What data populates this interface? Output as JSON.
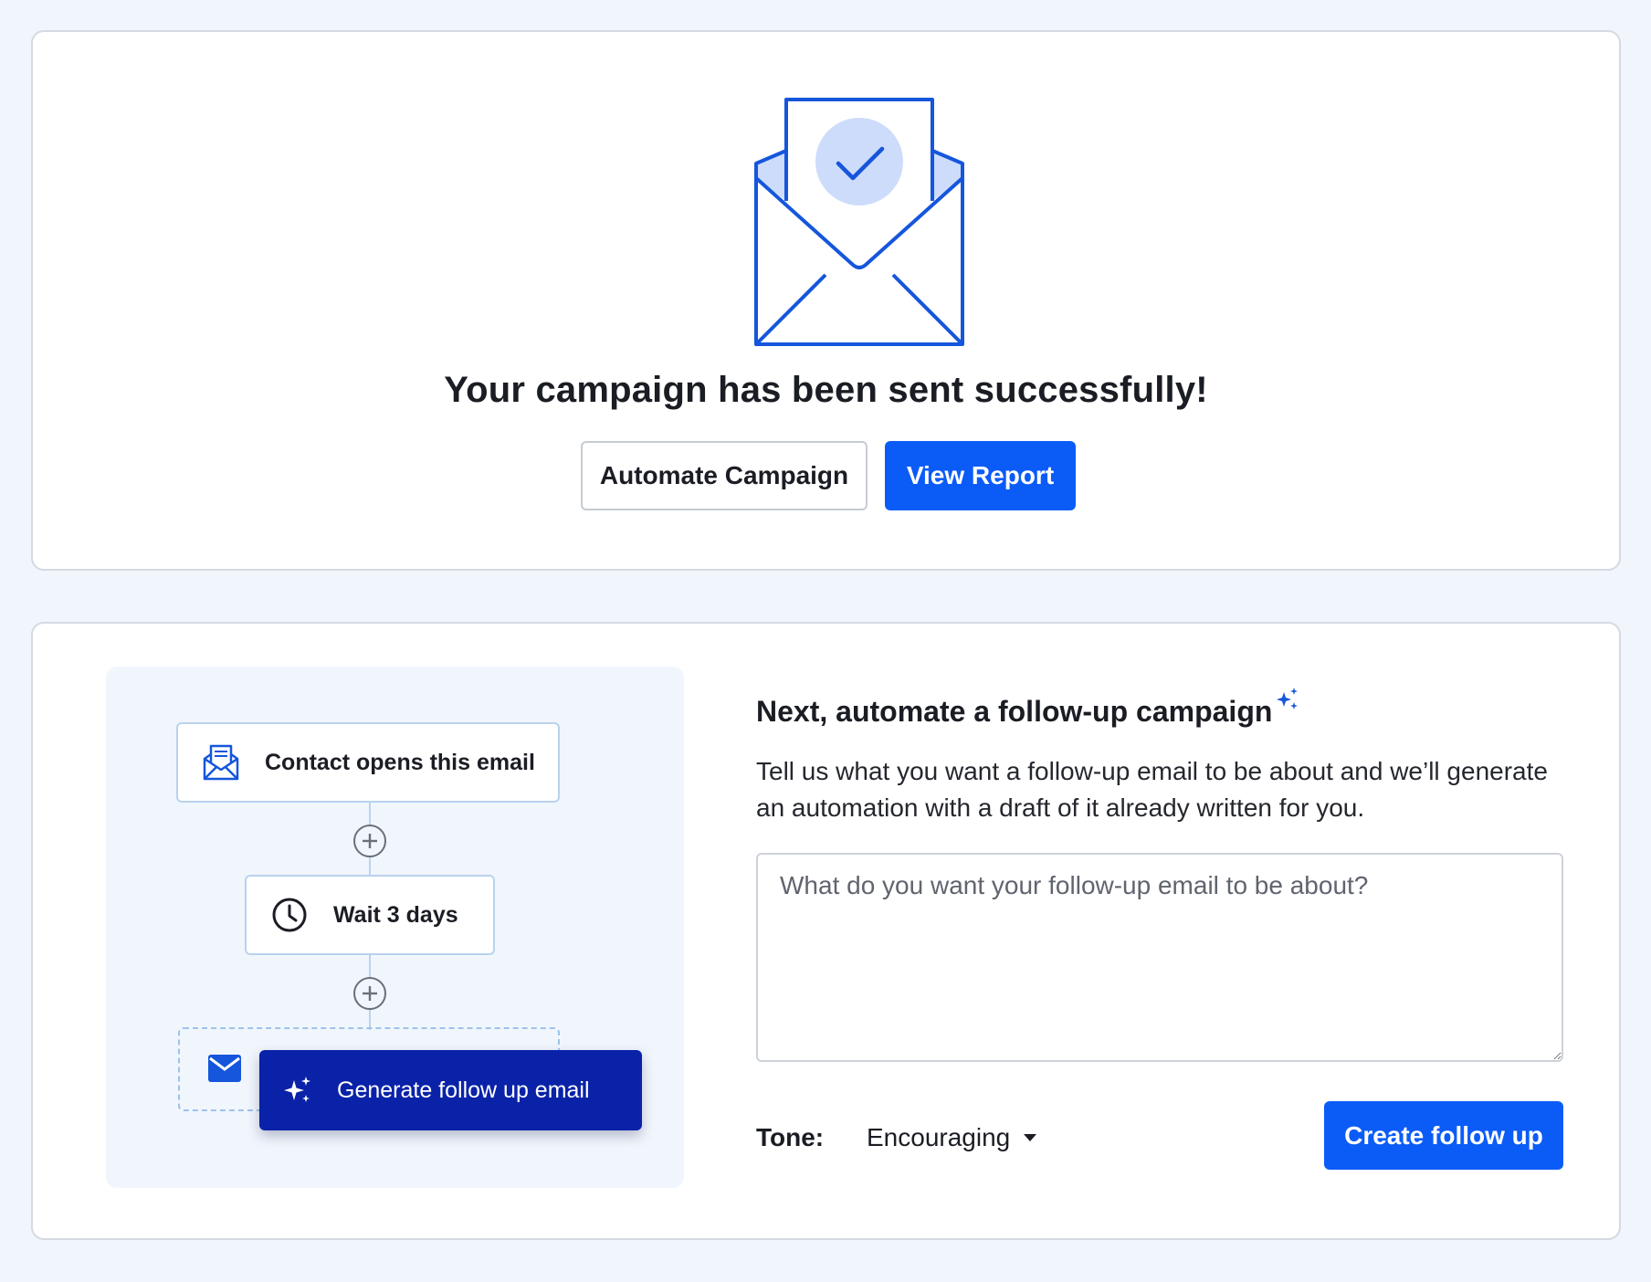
{
  "success": {
    "title": "Your campaign has been sent successfully!",
    "automate_label": "Automate Campaign",
    "report_label": "View Report",
    "illustration_icon": "envelope-check-icon"
  },
  "flow": {
    "trigger_label": "Contact opens this email",
    "trigger_icon": "email-open-icon",
    "wait_label": "Wait 3 days",
    "wait_icon": "clock-icon",
    "add_step_icon": "plus-circle-icon",
    "email_icon": "envelope-icon",
    "generate_label": "Generate follow up email",
    "generate_icon": "sparkles-icon"
  },
  "followup": {
    "heading": "Next, automate a follow-up campaign",
    "description": "Tell us what you want a follow-up email to be about and we’ll generate an automation with a draft of it already written for you.",
    "prompt_placeholder": "What do you want your follow-up email to be about?",
    "prompt_value": "",
    "tone_label": "Tone:",
    "tone_value": "Encouraging",
    "create_label": "Create follow up"
  },
  "colors": {
    "accent": "#0b5cf7",
    "accent_dark": "#0a22a8",
    "page_bg": "#f1f6fd",
    "icon_blue": "#1556dc",
    "icon_fill": "#cddcfa"
  }
}
